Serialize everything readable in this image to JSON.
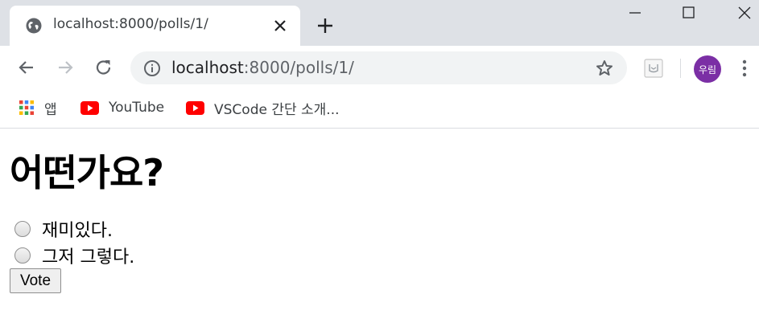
{
  "tab": {
    "title": "localhost:8000/polls/1/",
    "favicon": "globe-icon"
  },
  "window_controls": [
    "minimize-icon",
    "maximize-icon",
    "close-icon"
  ],
  "omnibox": {
    "url_host": "localhost",
    "url_rest": ":8000/polls/1/"
  },
  "profile": {
    "avatar_label": "우림",
    "avatar_color": "#7b2fa5"
  },
  "bookmarks": [
    {
      "label": "앱",
      "icon": "apps-grid-icon"
    },
    {
      "label": "YouTube",
      "icon": "youtube-icon"
    },
    {
      "label": "VSCode 간단 소개...",
      "icon": "youtube-icon"
    }
  ],
  "page": {
    "question": "어떤가요?",
    "choices": [
      {
        "label": "재미있다."
      },
      {
        "label": "그저 그렇다."
      }
    ],
    "vote_label": "Vote"
  }
}
